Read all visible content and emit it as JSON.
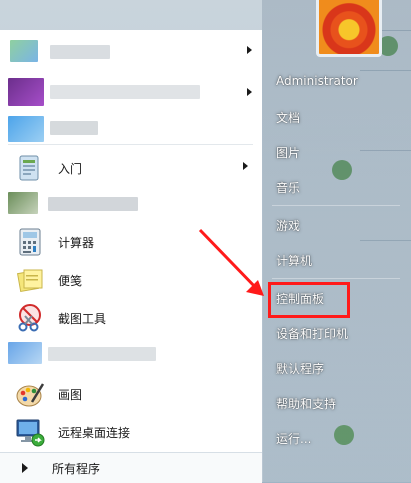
{
  "left_menu": {
    "items": [
      {
        "label": "入门",
        "has_submenu": true,
        "icon": "getting-started-icon"
      },
      {
        "label": "计算器",
        "has_submenu": false,
        "icon": "calculator-icon"
      },
      {
        "label": "便笺",
        "has_submenu": false,
        "icon": "sticky-notes-icon"
      },
      {
        "label": "截图工具",
        "has_submenu": false,
        "icon": "snipping-tool-icon"
      },
      {
        "label": "画图",
        "has_submenu": false,
        "icon": "paint-icon"
      },
      {
        "label": "远程桌面连接",
        "has_submenu": false,
        "icon": "remote-desktop-icon"
      }
    ],
    "all_programs_label": "所有程序"
  },
  "right_menu": {
    "user_name": "Administrator",
    "items": [
      "文档",
      "图片",
      "音乐",
      "游戏",
      "计算机",
      "控制面板",
      "设备和打印机",
      "默认程序",
      "帮助和支持",
      "运行..."
    ]
  },
  "colors": {
    "highlight_box": "#ff1a1a",
    "annotation_arrow": "#ff1a1a"
  }
}
